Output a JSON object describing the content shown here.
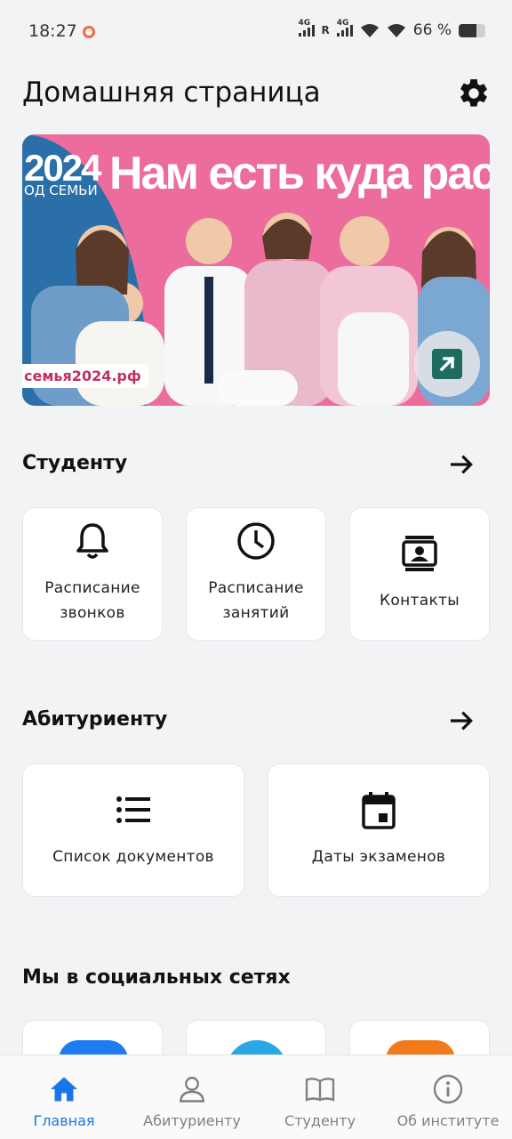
{
  "status_bar": {
    "time": "18:27",
    "network1": "4G",
    "network2": "4G",
    "roaming": "R",
    "battery_text": "66 %",
    "battery_level": 0.66
  },
  "header": {
    "title": "Домашняя страница"
  },
  "banner": {
    "year": "2024",
    "year_sub": "ОД СЕМЬИ",
    "headline": "Нам есть куда расти",
    "site": "семья2024.рф"
  },
  "student": {
    "title": "Студенту",
    "cards": [
      {
        "line1": "Расписание",
        "line2": "звонков",
        "icon": "bell-icon"
      },
      {
        "line1": "Расписание",
        "line2": "занятий",
        "icon": "clock-icon"
      },
      {
        "line1": "Контакты",
        "icon": "contacts-icon"
      }
    ]
  },
  "applicant": {
    "title": "Абитуриенту",
    "cards": [
      {
        "label": "Список документов",
        "icon": "list-icon"
      },
      {
        "label": "Даты экзаменов",
        "icon": "calendar-icon"
      }
    ]
  },
  "social": {
    "title": "Мы в социальных сетях",
    "colors": [
      "#1e7cf2",
      "#2aa7e6",
      "#f27a1a"
    ]
  },
  "nav": {
    "items": [
      {
        "label": "Главная",
        "icon": "home-icon",
        "active": true
      },
      {
        "label": "Абитуриенту",
        "icon": "person-icon"
      },
      {
        "label": "Студенту",
        "icon": "book-icon"
      },
      {
        "label": "Об институте",
        "icon": "info-icon"
      }
    ],
    "active_color": "#1976e6",
    "inactive_color": "#808080"
  }
}
